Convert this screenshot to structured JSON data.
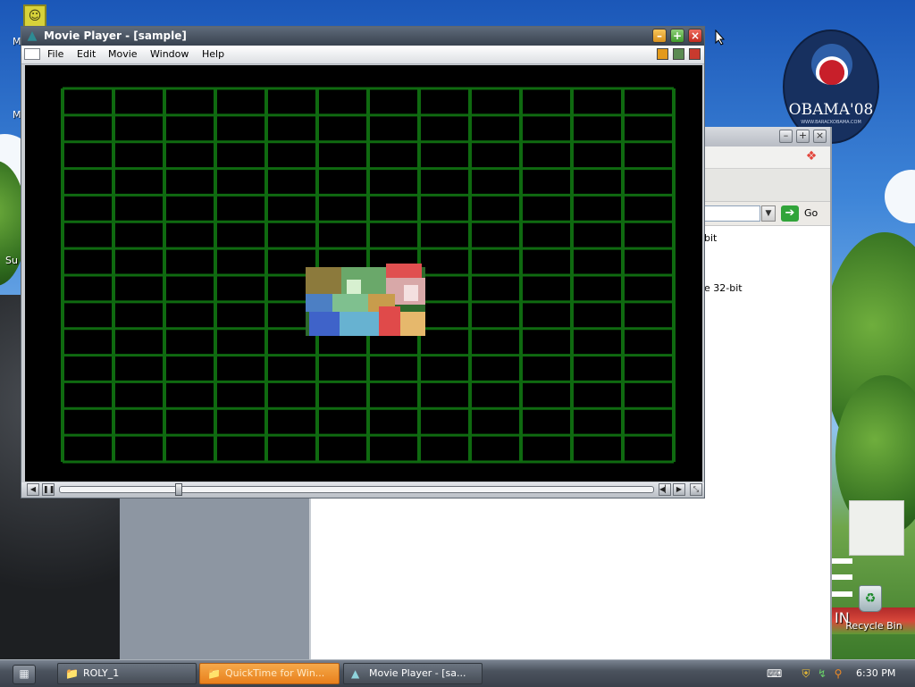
{
  "desktop": {
    "campaign_badge": {
      "text": "OBAMA'08",
      "sub": "WWW.BARACKOBAMA.COM"
    },
    "recycle_bin_label": "Recycle Bin",
    "side_letters": [
      "M",
      "M",
      "Su",
      "IN"
    ]
  },
  "background_window": {
    "address_go_label": "Go",
    "text_lines": [
      "bit",
      "e 32-bit"
    ]
  },
  "movie_player": {
    "title": "Movie Player - [sample]",
    "menu": [
      "File",
      "Edit",
      "Movie",
      "Window",
      "Help"
    ],
    "title_buttons": {
      "minimize": "–",
      "maximize": "+",
      "close": "×"
    },
    "playback_position": 0.2,
    "video_grid": {
      "columns": 12,
      "rows": 14,
      "color": "#0f6a10"
    }
  },
  "taskbar": {
    "tasks": [
      {
        "label": "ROLY_1",
        "icon": "folder-icon",
        "active": false
      },
      {
        "label": "QuickTime for Win...",
        "icon": "folder-icon",
        "active": true
      },
      {
        "label": "Movie Player - [sa...",
        "icon": "movie-player-icon",
        "active": false
      }
    ],
    "clock": "6:30 PM"
  },
  "colors": {
    "accent_task": "#e8801c",
    "title_bar": "#38424f",
    "video_grid": "#0f6a10"
  }
}
